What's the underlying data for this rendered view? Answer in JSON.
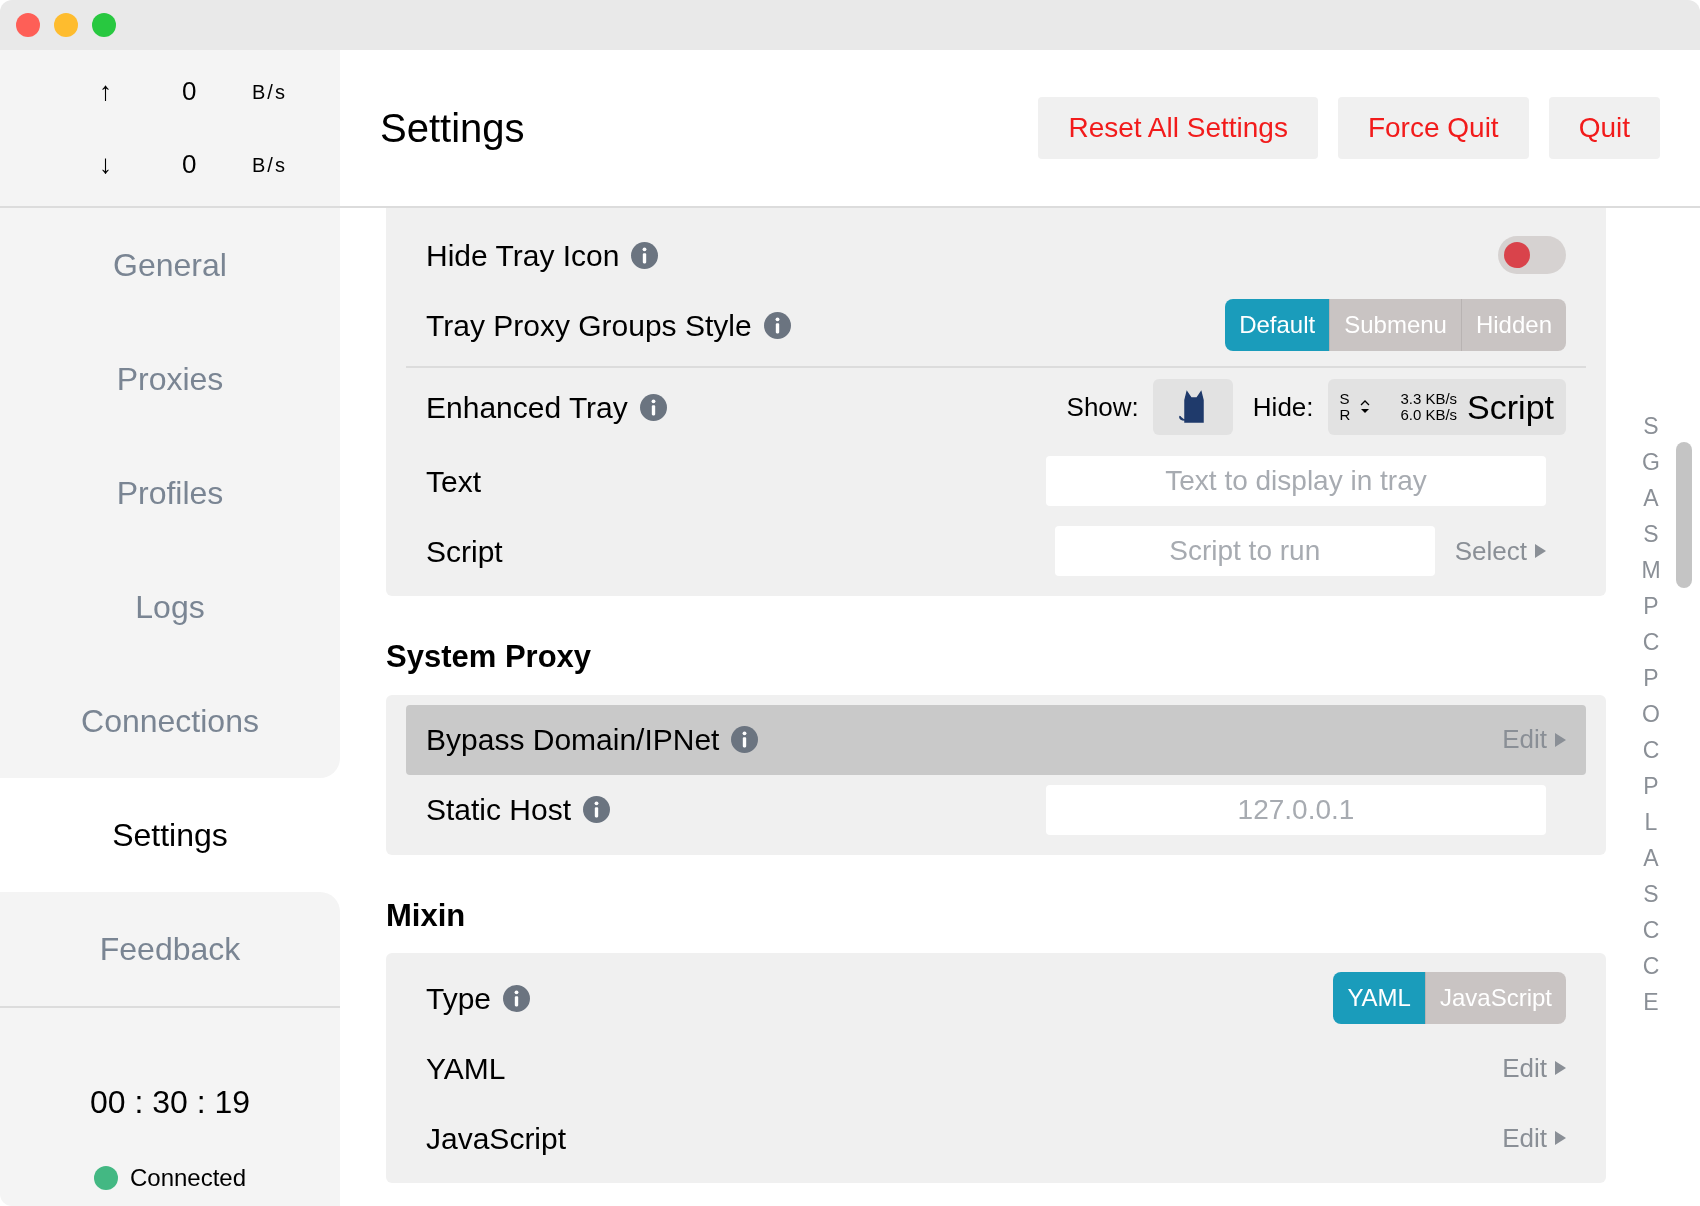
{
  "traffic": [
    {
      "arrow": "↑",
      "value": "0",
      "unit": "B/s"
    },
    {
      "arrow": "↓",
      "value": "0",
      "unit": "B/s"
    }
  ],
  "nav": [
    {
      "label": "General",
      "selected": false
    },
    {
      "label": "Proxies",
      "selected": false
    },
    {
      "label": "Profiles",
      "selected": false
    },
    {
      "label": "Logs",
      "selected": false
    },
    {
      "label": "Connections",
      "selected": false
    },
    {
      "label": "Settings",
      "selected": true
    },
    {
      "label": "Feedback",
      "selected": false
    }
  ],
  "timer": "00 : 30 : 19",
  "status": {
    "label": "Connected",
    "color": "#43b883"
  },
  "header": {
    "title": "Settings",
    "buttons": [
      "Reset All Settings",
      "Force Quit",
      "Quit"
    ]
  },
  "sections": [
    {
      "rows": [
        {
          "kind": "toggle",
          "label": "Hide Tray Icon",
          "info": true,
          "on": false
        },
        {
          "kind": "segmented",
          "label": "Tray Proxy Groups Style",
          "info": true,
          "options": [
            {
              "label": "Default",
              "selected": true
            },
            {
              "label": "Submenu",
              "selected": false
            },
            {
              "label": "Hidden",
              "selected": false
            }
          ]
        },
        {
          "kind": "enhanced",
          "label": "Enhanced Tray",
          "info": true,
          "divider_before": true,
          "show_label": "Show:",
          "hide_label": "Hide:",
          "preview": {
            "s": "S",
            "r": "R",
            "up": "3.3 KB/s",
            "down": "6.0 KB/s",
            "text": "Script"
          }
        },
        {
          "kind": "input",
          "label": "Text",
          "info": false,
          "placeholder": "Text to display in tray"
        },
        {
          "kind": "input",
          "label": "Script",
          "info": false,
          "placeholder": "Script to run",
          "action": "Select"
        }
      ]
    },
    {
      "title": "System Proxy",
      "rows": [
        {
          "kind": "edit",
          "label": "Bypass Domain/IPNet",
          "info": true,
          "action": "Edit",
          "highlighted": true
        },
        {
          "kind": "input",
          "label": "Static Host",
          "info": true,
          "placeholder": "127.0.0.1"
        }
      ]
    },
    {
      "title": "Mixin",
      "rows": [
        {
          "kind": "segmented",
          "label": "Type",
          "info": true,
          "options": [
            {
              "label": "YAML",
              "selected": true
            },
            {
              "label": "JavaScript",
              "selected": false
            }
          ]
        },
        {
          "kind": "edit",
          "label": "YAML",
          "info": false,
          "action": "Edit",
          "highlighted": false
        },
        {
          "kind": "edit",
          "label": "JavaScript",
          "info": false,
          "action": "Edit",
          "highlighted": false
        }
      ]
    }
  ],
  "index": [
    "S",
    "G",
    "A",
    "S",
    "M",
    "P",
    "C",
    "P",
    "O",
    "C",
    "P",
    "L",
    "A",
    "S",
    "C",
    "C",
    "E"
  ]
}
